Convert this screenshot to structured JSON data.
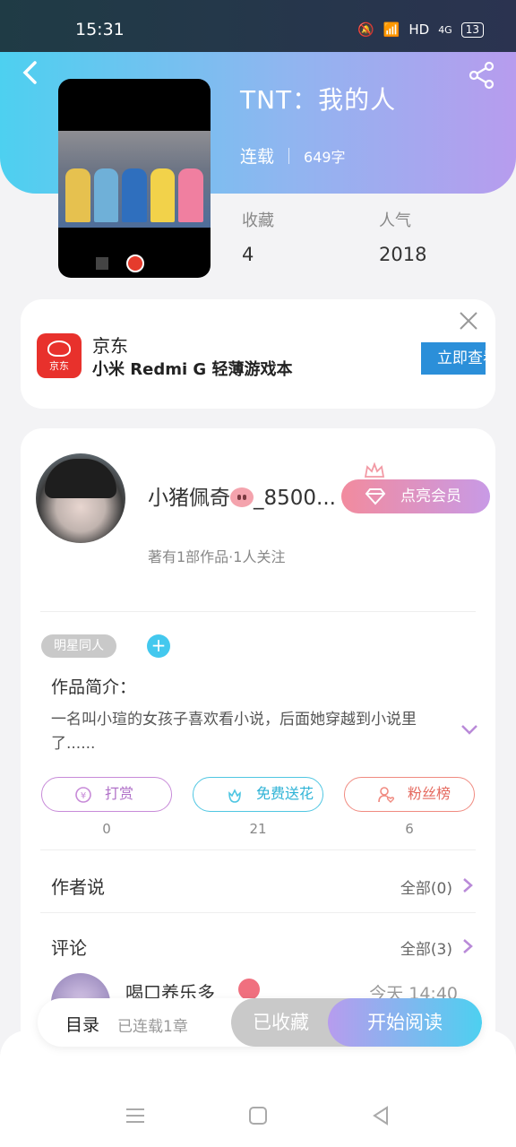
{
  "status_bar": {
    "time": "15:31",
    "network": "HD",
    "signal": "4G",
    "battery": "13"
  },
  "book": {
    "title": "TNT：我的人",
    "status": "连载",
    "word_count": "649字",
    "favorites_label": "收藏",
    "favorites_value": "4",
    "popularity_label": "人气",
    "popularity_value": "2018"
  },
  "ad": {
    "brand": "京东",
    "logo_text": "京东",
    "description": "小米 Redmi G 轻薄游戏本",
    "button": "立即查看"
  },
  "author": {
    "name": "小猪佩奇",
    "name_suffix": "_8500...",
    "meta": "著有1部作品·1人关注",
    "vip_button": "点亮会员"
  },
  "tags": [
    "明星同人"
  ],
  "add_tag": "+",
  "intro": {
    "title": "作品简介：",
    "text": "一名叫小瑄的女孩子喜欢看小说，后面她穿越到小说里了......"
  },
  "actions": [
    {
      "label": "打赏",
      "count": "0",
      "color": "#c78ad8"
    },
    {
      "label": "免费送花",
      "count": "21",
      "color": "#4fc6e2"
    },
    {
      "label": "粉丝榜",
      "count": "6",
      "color": "#f08a80"
    }
  ],
  "author_says": {
    "label": "作者说",
    "all": "全部(0)"
  },
  "comments": {
    "label": "评论",
    "all": "全部(3)",
    "first": {
      "user": "喝口养乐多",
      "time": "今天 14:40"
    }
  },
  "bottom_bar": {
    "toc": "目录",
    "toc_status": "已连载1章",
    "collected": "已收藏",
    "read": "开始阅读"
  },
  "colors": {
    "accent_cyan": "#4dd0f0",
    "accent_purple": "#b79cee",
    "jd_red": "#e8312c"
  }
}
